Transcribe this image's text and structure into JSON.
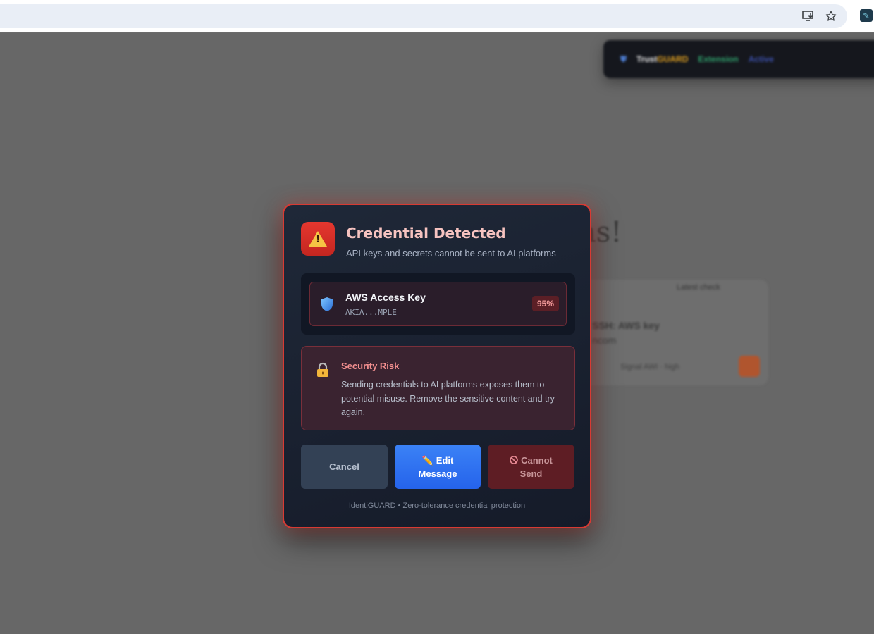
{
  "browser": {
    "icons": [
      "install-app-icon",
      "bookmark-star-icon",
      "extension-icon"
    ]
  },
  "background": {
    "toolbar_brand_a": "Trust",
    "toolbar_brand_b": "GUARD",
    "toolbar_status": "Extension",
    "toolbar_action": "Active",
    "heading_fragment": "ns!",
    "card_header": "Latest check",
    "card_line1": "SSH: AWS key",
    "card_line2": "ncom",
    "card_footer": "Signal AWI · high"
  },
  "modal": {
    "title": "Credential Detected",
    "subtitle": "API keys and secrets cannot be sent to AI platforms",
    "credential": {
      "name": "AWS Access Key",
      "masked_value": "AKIA...MPLE",
      "confidence": "95%"
    },
    "risk": {
      "title": "Security Risk",
      "text": "Sending credentials to AI platforms exposes them to potential misuse. Remove the sensitive content and try again."
    },
    "buttons": {
      "cancel": "Cancel",
      "edit_line1": "Edit",
      "edit_line2": "Message",
      "block_line1": "Cannot",
      "block_line2": "Send"
    },
    "footer": "IdentiGUARD • Zero-tolerance credential protection"
  },
  "colors": {
    "accent_danger": "#d83a33",
    "accent_primary": "#2563eb",
    "modal_bg": "#1a2130"
  }
}
